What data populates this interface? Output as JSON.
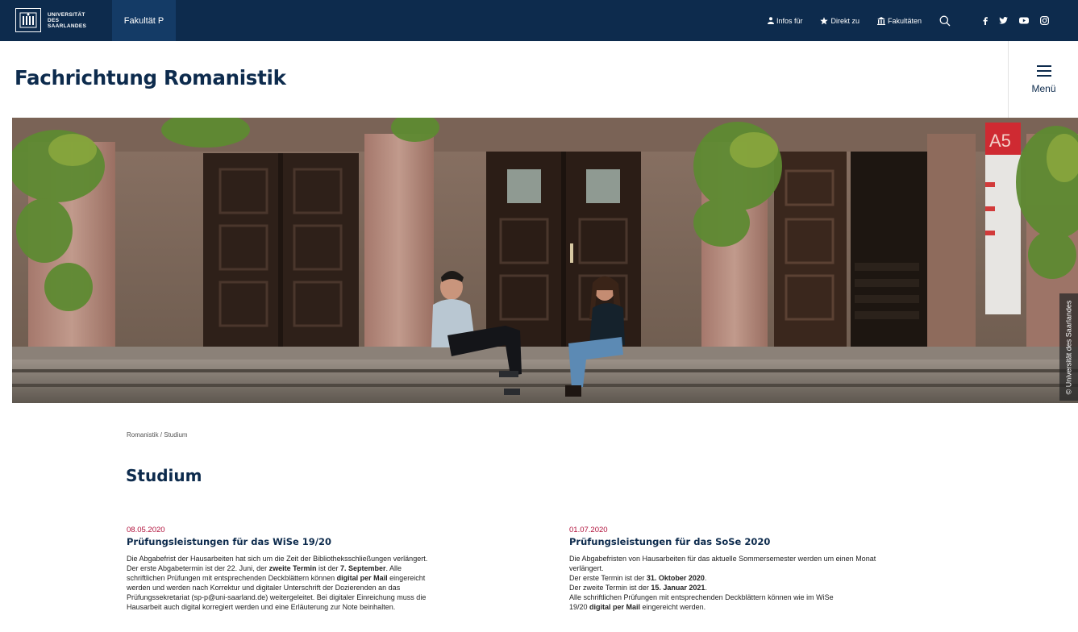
{
  "topbar": {
    "university_lines": [
      "UNIVERSITÄT",
      "DES",
      "SAARLANDES"
    ],
    "faculty_tab": "Fakultät P",
    "nav": [
      {
        "icon": "person-icon",
        "label": "Infos für"
      },
      {
        "icon": "star-icon",
        "label": "Direkt zu"
      },
      {
        "icon": "building-icon",
        "label": "Fakultäten"
      }
    ],
    "social": [
      "facebook-icon",
      "twitter-icon",
      "youtube-icon",
      "instagram-icon"
    ]
  },
  "header": {
    "title": "Fachrichtung Romanistik",
    "menu_label": "Menü"
  },
  "hero": {
    "building_sign": "A5",
    "credit": "© Universität des Saarlandes"
  },
  "main": {
    "breadcrumb": "Romanistik / Studium",
    "title": "Studium",
    "news": [
      {
        "date": "08.05.2020",
        "title": "Prüfungsleistungen für das WiSe 19/20",
        "body": [
          [
            "Die Abgabefrist der Hausarbeiten hat sich um die Zeit der Bibliotheksschließungen verlängert."
          ],
          [
            "Der erste Abgabetermin ist der 22. Juni, der ",
            "zweite Termin",
            " ist der ",
            "7. September",
            ". Alle"
          ],
          [
            "schriftlichen Prüfungen mit entsprechenden Deckblättern können ",
            "digital per Mail",
            " eingereicht"
          ],
          [
            "werden und werden nach Korrektur und digitaler Unterschrift der Dozierenden an das"
          ],
          [
            "Prüfungssekretariat (sp-p@uni-saarland.de) weitergeleitet. Bei digitaler Einreichung muss die"
          ],
          [
            "Hausarbeit auch digital korregiert werden und eine Erläuterung zur Note beinhalten."
          ]
        ]
      },
      {
        "date": "01.07.2020",
        "title": "Prüfungsleistungen für das SoSe 2020",
        "body": [
          [
            "Die Abgabefristen von Hausarbeiten für das aktuelle Sommersemester werden um einen Monat"
          ],
          [
            "verlängert."
          ],
          [
            "Der erste Termin ist der ",
            "31. Oktober 2020",
            "."
          ],
          [
            "Der zweite Termin ist der ",
            "15. Januar 2021",
            "."
          ],
          [
            "Alle schriftlichen Prüfungen mit entsprechenden Deckblättern können wie im WiSe"
          ],
          [
            "19/20 ",
            "digital per Mail",
            " eingereicht werden."
          ]
        ]
      }
    ]
  },
  "colors": {
    "navy": "#0d2b4d",
    "faculty_tab": "#143b66",
    "date_red": "#b0103a"
  }
}
